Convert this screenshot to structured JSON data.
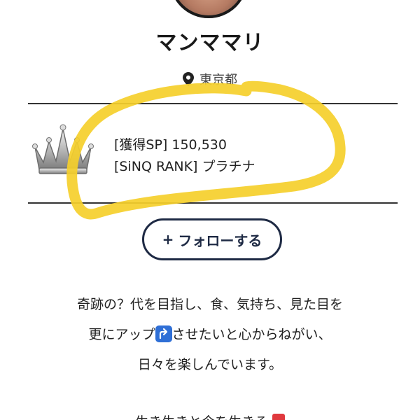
{
  "profile": {
    "username": "マンママリ",
    "location": "東京都"
  },
  "rank": {
    "points_line": "[獲得SP] 150,530",
    "rank_line": "[SiNQ RANK] プラチナ"
  },
  "follow_button": {
    "plus": "+",
    "label": "フォローする"
  },
  "bio": {
    "line1": "奇跡の？代を目指し、食、気持ち、見た目を",
    "line2_before": "更にアップ",
    "line2_after": "させたいと心からねがい、",
    "line3": "日々を楽しんでいます。",
    "line4_partial": "生き生きと今を生きる"
  },
  "icons": {
    "location": "map-pin-icon",
    "crown": "crown-icon",
    "up": "up-arrow-emoji",
    "heart": "heart-emoji"
  },
  "colors": {
    "highlight": "#f5cf2b",
    "button_border": "#1e2a44",
    "up_emoji": "#2f6fd6"
  }
}
